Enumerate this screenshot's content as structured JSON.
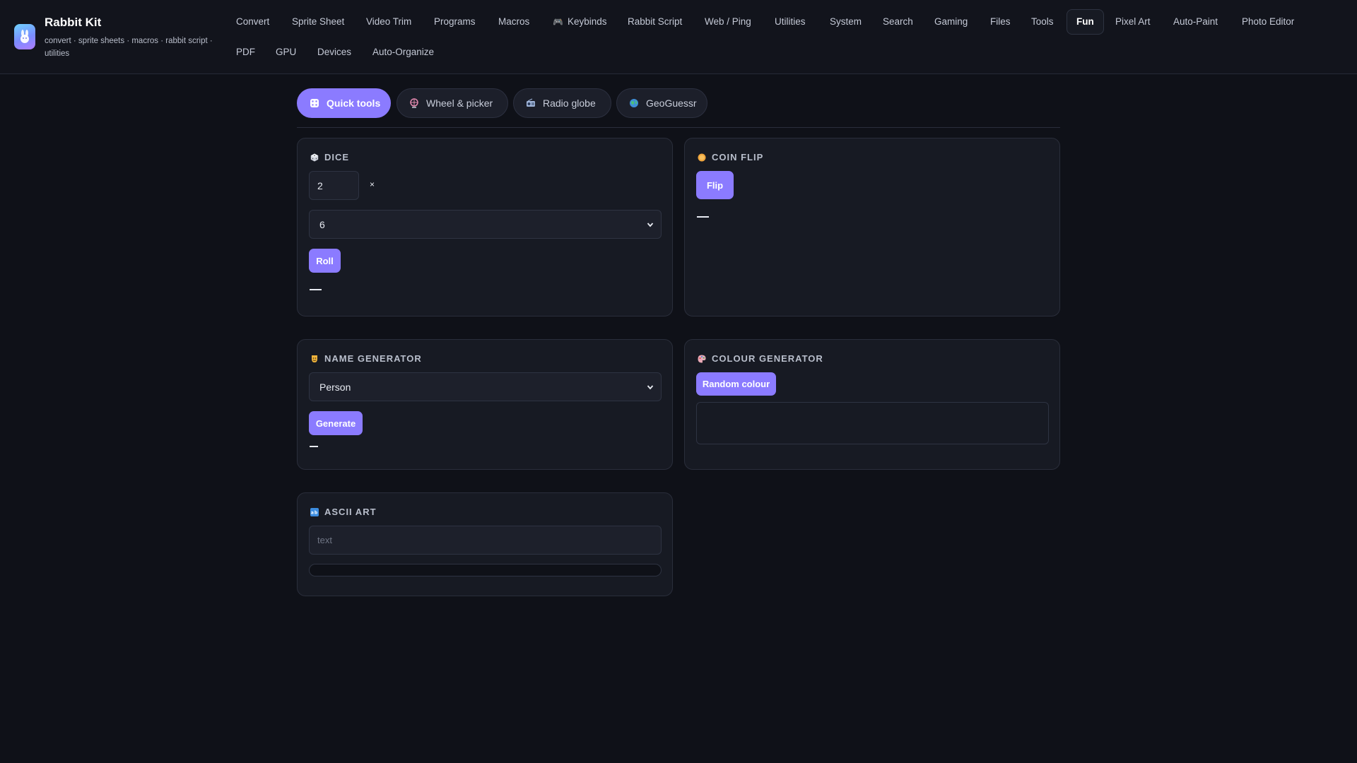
{
  "app": {
    "title": "Rabbit Kit",
    "subtitle": "convert · sprite sheets · macros · rabbit script · utilities"
  },
  "nav": {
    "row1": [
      "Convert",
      "Sprite Sheet",
      "Video Trim",
      "Programs",
      "Macros",
      "Keybinds",
      "Rabbit Script",
      "Web / Ping",
      "Utilities",
      "System",
      "Search",
      "Gaming",
      "Files",
      "Tools",
      "Fun",
      "Pixel Art",
      "Auto-Paint",
      "Photo Editor"
    ],
    "row2": [
      "PDF",
      "GPU",
      "Devices",
      "Auto-Organize"
    ],
    "active": "Fun",
    "keybinds_icon": "gamepad-icon"
  },
  "subtabs": [
    {
      "label": "Quick tools",
      "icon": "dice-icon",
      "active": true
    },
    {
      "label": "Wheel & picker",
      "icon": "ferris-wheel-icon",
      "active": false
    },
    {
      "label": "Radio globe",
      "icon": "radio-icon",
      "active": false
    },
    {
      "label": "GeoGuessr",
      "icon": "globe-icon",
      "active": false
    }
  ],
  "dice": {
    "title": "DICE",
    "count": "2",
    "times": "×",
    "sides": "6",
    "roll_label": "Roll",
    "result": "—"
  },
  "coin": {
    "title": "COIN FLIP",
    "flip_label": "Flip",
    "result": "—"
  },
  "name_gen": {
    "title": "NAME GENERATOR",
    "type": "Person",
    "generate_label": "Generate",
    "result": "—"
  },
  "colour_gen": {
    "title": "COLOUR GENERATOR",
    "button_label": "Random colour",
    "output": ""
  },
  "ascii": {
    "title": "ASCII ART",
    "placeholder": "text",
    "value": ""
  },
  "colors": {
    "accent": "#8b7bff",
    "background": "#0f1118",
    "card": "#171a23"
  }
}
